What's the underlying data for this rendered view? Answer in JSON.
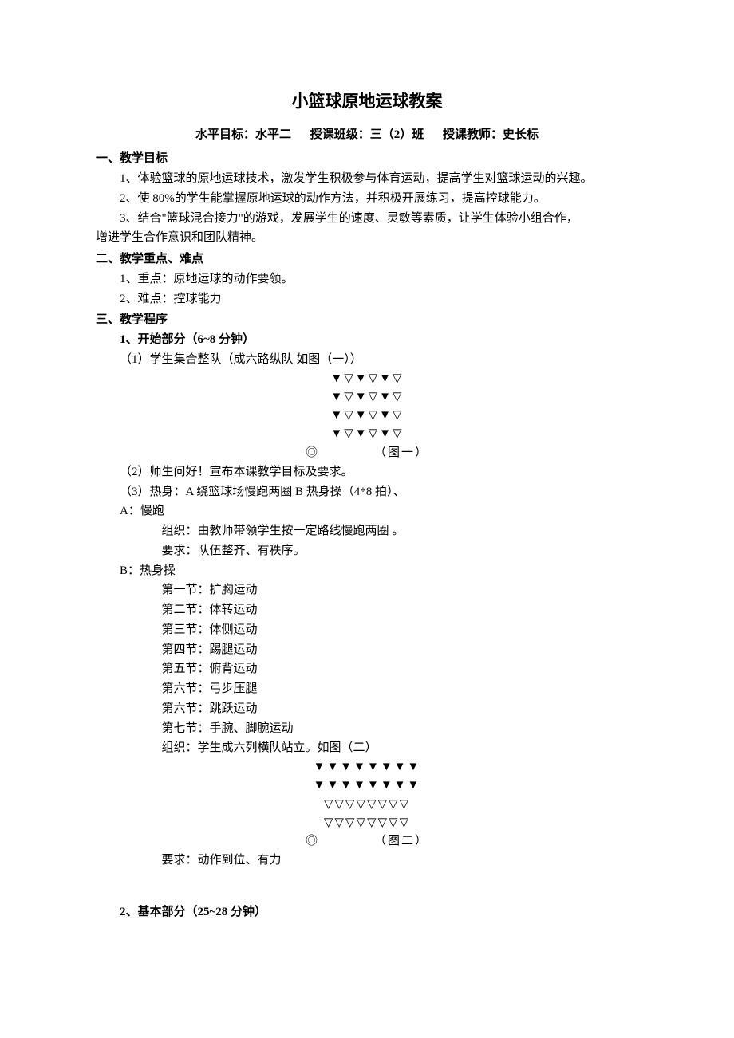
{
  "title": "小篮球原地运球教案",
  "meta": {
    "level_label": "水平目标：水平二",
    "class_label": "授课班级：三（2）班",
    "teacher_label": "授课教师：史长标"
  },
  "sec1": {
    "heading": "一、教学目标",
    "p1": "1、体验篮球的原地运球技术，激发学生积极参与体育运动，提高学生对篮球运动的兴趣。",
    "p2": "2、使 80%的学生能掌握原地运球的动作方法，并积极开展练习，提高控球能力。",
    "p3a": "3、结合\"篮球混合接力\"的游戏，发展学生的速度、灵敏等素质，让学生体验小组合作，",
    "p3b": "增进学生合作意识和团队精神。"
  },
  "sec2": {
    "heading": "二、教学重点、难点",
    "p1": "1、重点：原地运球的动作要领。",
    "p2": "2、难点：控球能力"
  },
  "sec3": {
    "heading": "三、教学程序",
    "part1": {
      "heading": "1、开始部分（6~8 分钟）",
      "item1": "（1）学生集合整队（成六路纵队 如图（一））",
      "diagram1": {
        "r1": "▼▽▼▽▼▽",
        "r2": "▼▽▼▽▼▽",
        "r3": "▼▽▼▽▼▽",
        "r4": "▼▽▼▽▼▽",
        "r5": "◎            （图一）"
      },
      "item2": "（2）师生问好！宣布本课教学目标及要求。",
      "item3": "（3）热身：A 绕篮球场慢跑两圈 B 热身操（4*8 拍）、",
      "a_label": "A：慢跑",
      "a_org": "组织：由教师带领学生按一定路线慢跑两圈 。",
      "a_req": "要求：队伍整齐、有秩序。",
      "b_label": "B：热身操",
      "b1": "第一节：扩胸运动",
      "b2": "第二节：体转运动",
      "b3": "第三节：体侧运动",
      "b4": "第四节：踢腿运动",
      "b5": "第五节：俯背运动",
      "b6": "第六节：弓步压腿",
      "b7": "第六节：跳跃运动",
      "b8": "第七节：手腕、脚腕运动",
      "b_org": "组织：学生成六列横队站立。如图（二）",
      "diagram2": {
        "r1": "▼▼▼▼▼▼▼▼",
        "r2": "▼▼▼▼▼▼▼▼",
        "r3": "▽▽▽▽▽▽▽▽",
        "r4": "▽▽▽▽▽▽▽▽",
        "r5": "◎            （图二）"
      },
      "b_req": "要求：动作到位、有力"
    },
    "part2": {
      "heading": "2、基本部分（25~28 分钟）"
    }
  }
}
